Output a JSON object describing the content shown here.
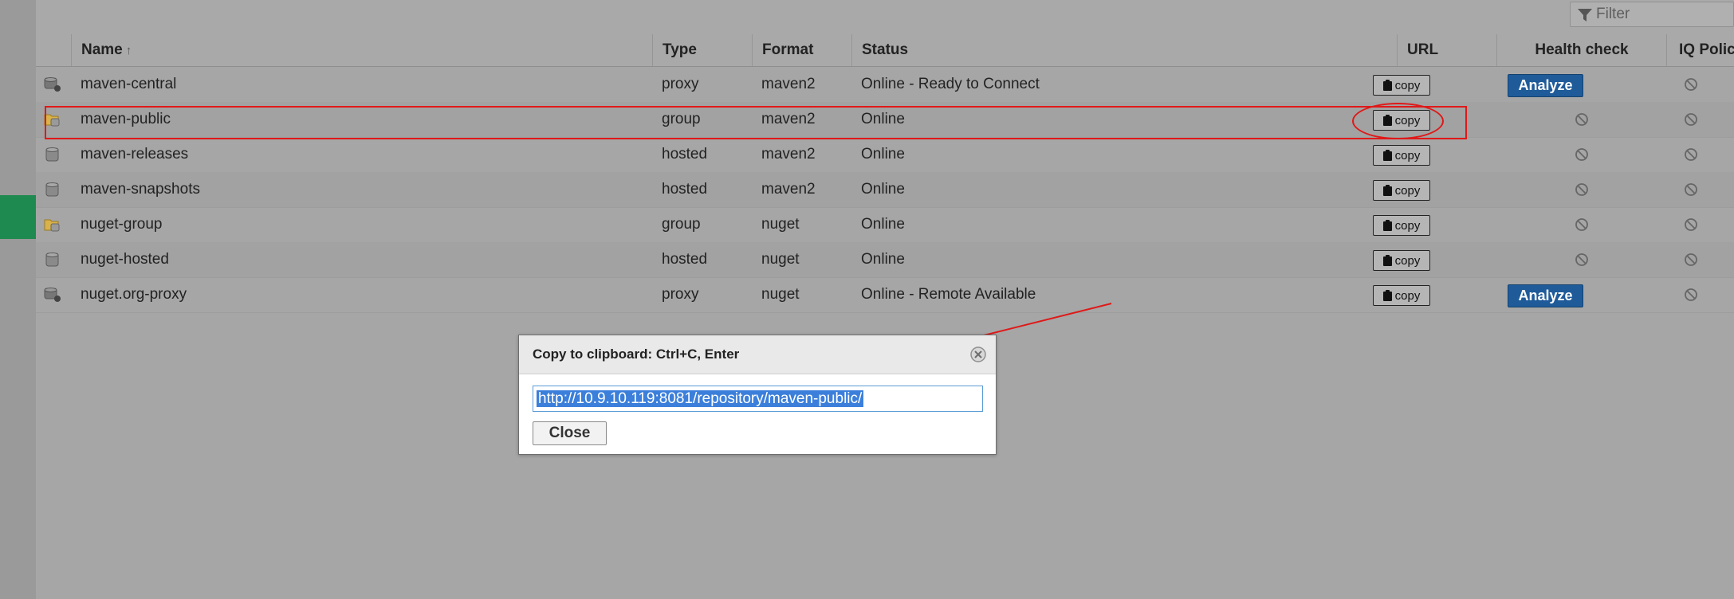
{
  "filter": {
    "placeholder": "Filter"
  },
  "columns": {
    "name": "Name",
    "type": "Type",
    "format": "Format",
    "status": "Status",
    "url": "URL",
    "health": "Health check",
    "iq": "IQ Policy Vi..."
  },
  "sort_indicator": "↑",
  "rows": [
    {
      "name": "maven-central",
      "type": "proxy",
      "format": "maven2",
      "status": "Online - Ready to Connect",
      "copy": "copy",
      "health_action": "Analyze",
      "icon": "proxy-repo-icon"
    },
    {
      "name": "maven-public",
      "type": "group",
      "format": "maven2",
      "status": "Online",
      "copy": "copy",
      "icon": "group-repo-icon"
    },
    {
      "name": "maven-releases",
      "type": "hosted",
      "format": "maven2",
      "status": "Online",
      "copy": "copy",
      "icon": "hosted-repo-icon"
    },
    {
      "name": "maven-snapshots",
      "type": "hosted",
      "format": "maven2",
      "status": "Online",
      "copy": "copy",
      "icon": "hosted-repo-icon"
    },
    {
      "name": "nuget-group",
      "type": "group",
      "format": "nuget",
      "status": "Online",
      "copy": "copy",
      "icon": "group-repo-icon"
    },
    {
      "name": "nuget-hosted",
      "type": "hosted",
      "format": "nuget",
      "status": "Online",
      "copy": "copy",
      "icon": "hosted-repo-icon"
    },
    {
      "name": "nuget.org-proxy",
      "type": "proxy",
      "format": "nuget",
      "status": "Online - Remote Available",
      "copy": "copy",
      "health_action": "Analyze",
      "icon": "proxy-repo-icon"
    }
  ],
  "dialog": {
    "title": "Copy to clipboard: Ctrl+C, Enter",
    "url": "http://10.9.10.119:8081/repository/maven-public/",
    "close_label": "Close"
  },
  "colors": {
    "annotation": "#e01818",
    "analyze": "#1f5b99",
    "active_nav": "#1f8a4f",
    "selection": "#3b7fdb"
  }
}
